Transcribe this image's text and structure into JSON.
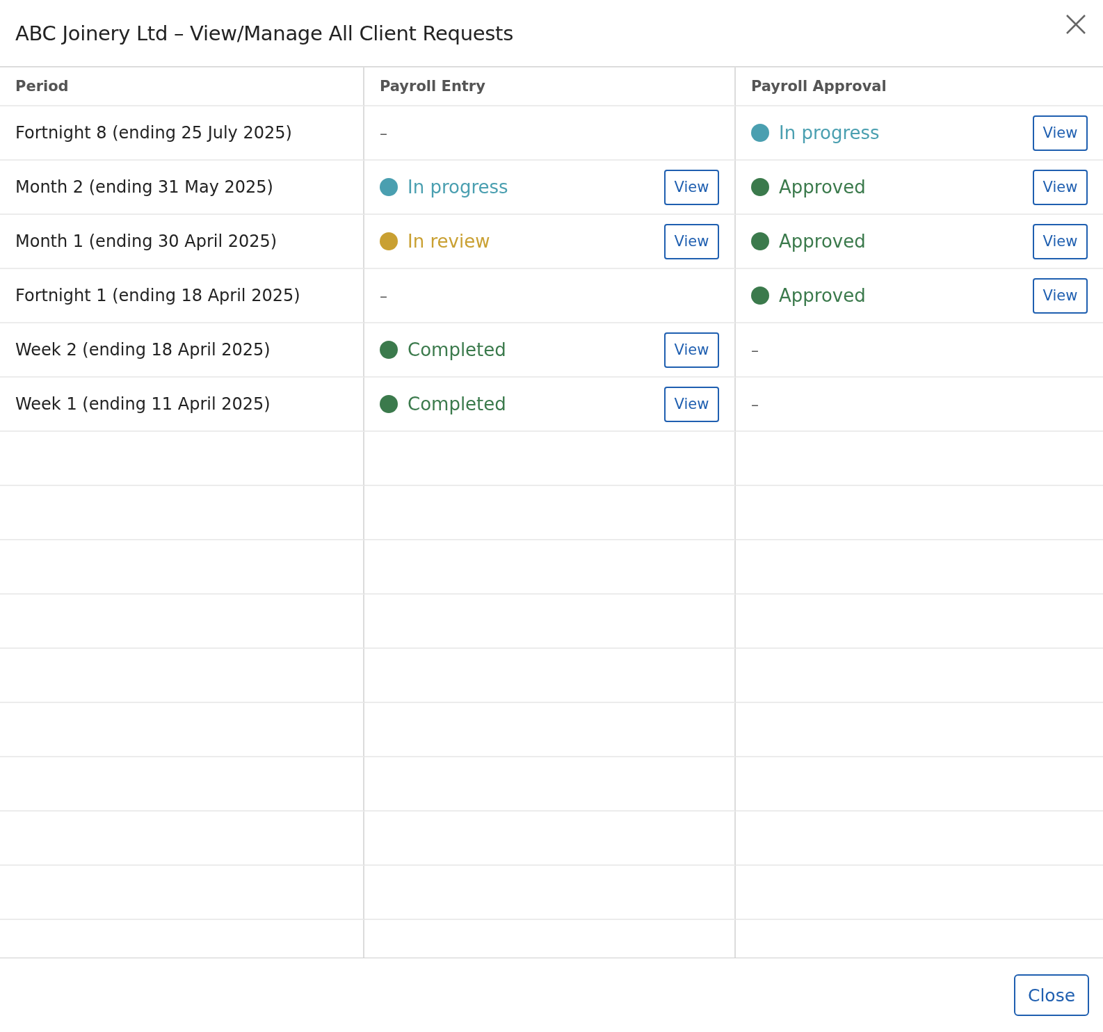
{
  "dialog": {
    "title": "ABC Joinery Ltd – View/Manage All Client Requests"
  },
  "table": {
    "columns": [
      "Period",
      "Payroll Entry",
      "Payroll Approval"
    ],
    "rows": [
      {
        "period": "Fortnight 8 (ending 25 July 2025)",
        "entry": {
          "kind": "empty",
          "text": "–"
        },
        "approval": {
          "kind": "status",
          "label": "In progress",
          "color": "#4a9fb0",
          "action": "View"
        }
      },
      {
        "period": "Month 2 (ending 31 May 2025)",
        "entry": {
          "kind": "status",
          "label": "In progress",
          "color": "#4a9fb0",
          "action": "View"
        },
        "approval": {
          "kind": "status",
          "label": "Approved",
          "color": "#3b7a4c",
          "action": "View"
        }
      },
      {
        "period": "Month 1 (ending 30 April 2025)",
        "entry": {
          "kind": "status",
          "label": "In review",
          "color": "#c9a032",
          "action": "View"
        },
        "approval": {
          "kind": "status",
          "label": "Approved",
          "color": "#3b7a4c",
          "action": "View"
        }
      },
      {
        "period": "Fortnight 1 (ending 18 April 2025)",
        "entry": {
          "kind": "empty",
          "text": "–"
        },
        "approval": {
          "kind": "status",
          "label": "Approved",
          "color": "#3b7a4c",
          "action": "View"
        }
      },
      {
        "period": "Week 2 (ending 18 April 2025)",
        "entry": {
          "kind": "status",
          "label": "Completed",
          "color": "#3b7a4c",
          "action": "View"
        },
        "approval": {
          "kind": "empty",
          "text": "–"
        }
      },
      {
        "period": "Week 1 (ending 11 April 2025)",
        "entry": {
          "kind": "status",
          "label": "Completed",
          "color": "#3b7a4c",
          "action": "View"
        },
        "approval": {
          "kind": "empty",
          "text": "–"
        }
      }
    ]
  },
  "footer": {
    "button": "Close"
  }
}
